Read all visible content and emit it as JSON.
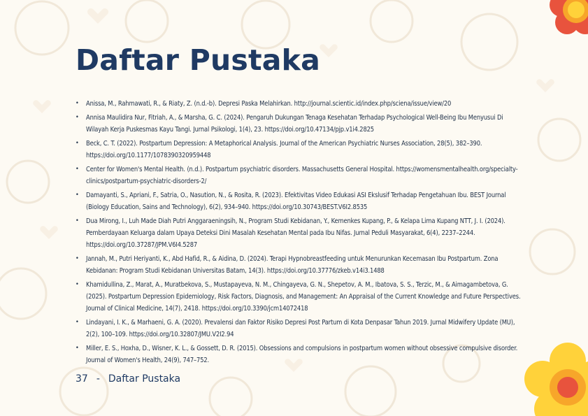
{
  "title": "Daftar Pustaka",
  "references": [
    "Anissa, M., Rahmawati, R., & Riaty, Z. (n.d.-b). Depresi Paska Melahirkan. http://journal.scientic.id/index.php/sciena/issue/view/20",
    "Annisa Maulidira Nur, Fitriah, A., & Marsha, G. C. (2024). Pengaruh Dukungan Tenaga Kesehatan Terhadap Psychological Well-Being Ibu Menyusui Di Wilayah Kerja Puskesmas Kayu Tangi. Jurnal Psikologi, 1(4), 23. https://doi.org/10.47134/pjp.v1i4.2825",
    "Beck, C. T. (2022). Postpartum Depression: A Metaphorical Analysis. Journal of the American Psychiatric Nurses Association, 28(5), 382–390. https://doi.org/10.1177/1078390320959448",
    "Center for Women's Mental Health. (n.d.). Postpartum psychiatric disorders. Massachusetts General Hospital. https://womensmentalhealth.org/specialty-clinics/postpartum-psychiatric-disorders-2/",
    "Damayanti, S., Apriani, F., Satria, O., Nasution, N., & Rosita, R. (2023). Efektivitas Video Edukasi ASI Ekslusif Terhadap Pengetahuan Ibu. BEST Journal (Biology Education, Sains and Technology), 6(2), 934–940. https://doi.org/10.30743/BEST.V6I2.8535",
    "Dua Mirong, I., Luh Made Diah Putri Anggaraeningsih, N., Program Studi Kebidanan, Y., Kemenkes Kupang, P., & Kelapa Lima Kupang NTT, J. I. (2024). Pemberdayaan Keluarga dalam Upaya Deteksi Dini Masalah Kesehatan Mental pada Ibu Nifas. Jurnal Peduli Masyarakat, 6(4), 2237–2244. https://doi.org/10.37287/JPM.V6I4.5287",
    "Jannah, M., Putri Heriyanti, K., Abd Hafid, R., & Aidina, D. (2024). Terapi Hypnobreastfeeding untuk Menurunkan Kecemasan Ibu Postpartum. Zona Kebidanan: Program Studi Kebidanan Universitas Batam, 14(3). https://doi.org/10.37776/zkeb.v14i3.1488",
    "Khamidullina, Z., Marat, A., Muratbekova, S., Mustapayeva, N. M., Chingayeva, G. N., Shepetov, A. M., Ibatova, S. S., Terzic, M., & Aimagambetova, G. (2025). Postpartum Depression Epidemiology, Risk Factors, Diagnosis, and Management: An Appraisal of the Current Knowledge and Future Perspectives. Journal of Clinical Medicine, 14(7), 2418. https://doi.org/10.3390/jcm14072418",
    "Lindayani, I. K., & Marhaeni, G. A. (2020). Prevalensi dan Faktor Risiko Depresi Post Partum di Kota Denpasar Tahun 2019. Jurnal Midwifery Update (MU), 2(2), 100–109. https://doi.org/10.32807/JMU.V2I2.94",
    "Miller, E. S., Hoxha, D., Wisner, K. L., & Gossett, D. R. (2015). Obsessions and compulsions in postpartum women without obsessive compulsive disorder. Journal of Women's Health, 24(9), 747–752."
  ],
  "footer": {
    "page_number": "37",
    "separator": "-",
    "section": "Daftar Pustaka"
  },
  "colors": {
    "title": "#1f3a63",
    "flower_red": "#e8533d",
    "flower_orange": "#f7a62a",
    "flower_yellow": "#ffd23a"
  }
}
